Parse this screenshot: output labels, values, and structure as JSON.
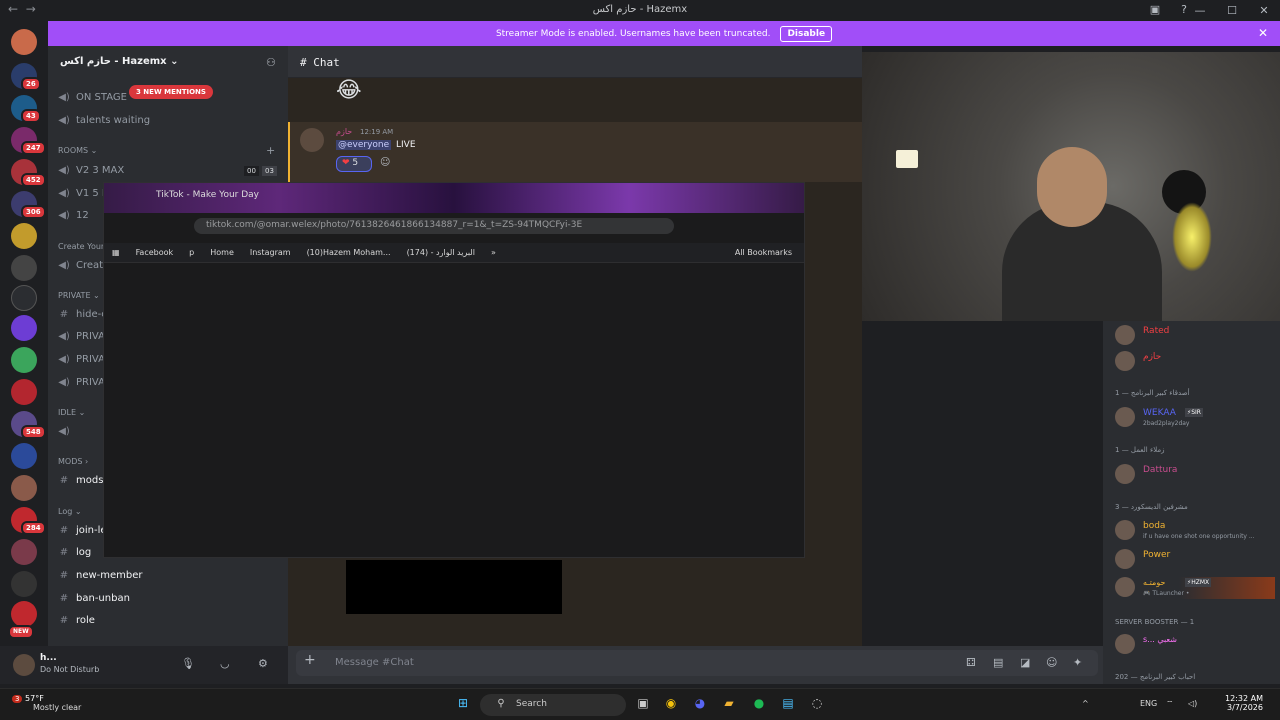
{
  "window": {
    "title": "حازم اكس - Hazemx",
    "nav_back": "←",
    "nav_forward": "→",
    "controls": [
      "—",
      "☐",
      "✕"
    ]
  },
  "banner": {
    "text": "Streamer Mode is enabled. Usernames have been truncated.",
    "disable_label": "Disable",
    "close": "✕"
  },
  "server": {
    "name": "حازم اكس - Hazemx ⌄",
    "mentions_badge": "3 NEW MENTIONS",
    "channels": [
      {
        "name": "ON STAGE"
      },
      {
        "name": "talents waiting"
      }
    ],
    "rooms_label": "ROOMS ⌄",
    "rooms": [
      {
        "name": "V2 3 MAX",
        "count_a": "00",
        "count_b": "03"
      },
      {
        "name": "V1 5 M"
      },
      {
        "name": "12"
      }
    ],
    "create_label": "Create Your",
    "create_item": "Create",
    "private_label": "PRIVATE ⌄",
    "private_items": [
      "hide-c",
      "PRIVA",
      "PRIVA",
      "PRIVA"
    ],
    "idle_label": "IDLE ⌄",
    "mods_label": "MODS ›",
    "mods_items": [
      "mods"
    ],
    "log_label": "Log ⌄",
    "log_items": [
      "join-le",
      "log",
      "new-member",
      "ban-unban",
      "role"
    ]
  },
  "guild_badges": [
    "26",
    "43",
    "247",
    "452",
    "306",
    "548",
    "284",
    "NEW"
  ],
  "user_panel": {
    "name": "h...",
    "status": "Do Not Disturb"
  },
  "chat": {
    "channel_name": "Chat",
    "emoji": "😂",
    "message": {
      "author": "حازم",
      "time": "12:19 AM",
      "mention": "@everyone",
      "text": "LIVE",
      "reaction_emoji": "❤",
      "reaction_count": "5"
    },
    "composer_placeholder": "Message #Chat"
  },
  "browser": {
    "tab_title": "TikTok - Make Your Day",
    "url": "tiktok.com/@omar.welex/photo/7613826461866134887_r=1&_t=ZS-94TMQCFyi-3E",
    "bookmarks": [
      "Facebook",
      "p",
      "Home",
      "Instagram",
      "(10)Hazem Moham...",
      "(174) - البريد الوارد",
      "»"
    ],
    "all_bookmarks": "All Bookmarks"
  },
  "members": {
    "top": [
      {
        "name": "Rated",
        "color": "#f23f43"
      },
      {
        "name": "حازم",
        "color": "#f23f43"
      }
    ],
    "groups": [
      {
        "label": "أصدقاء كبير البرنامج — 1",
        "members": [
          {
            "name": "WEKAA",
            "tag": "⚡SIR",
            "sub": "2bad2play2day",
            "color": "#5865f2"
          }
        ]
      },
      {
        "label": "زملاء العمل — 1",
        "members": [
          {
            "name": "Dattura",
            "color": "#c84d8e"
          }
        ]
      },
      {
        "label": "مشرفين الديسكورد — 3",
        "members": [
          {
            "name": "boda",
            "sub": "if u have one shot one opportunity ...",
            "color": "#f0b232"
          },
          {
            "name": "Power",
            "color": "#f0b232"
          },
          {
            "name": "حومتـه",
            "tag": "⚡HZMX",
            "sub": "🎮 TLauncher •",
            "color": "#f0b232"
          }
        ]
      },
      {
        "label": "SERVER BOOSTER — 1",
        "members": [
          {
            "name": "s... ‎شعبي",
            "color": "#ff73fa"
          }
        ]
      },
      {
        "label": "احباب كبير البرنامج — 202",
        "members": []
      }
    ]
  },
  "taskbar": {
    "weather_temp": "57°F",
    "weather_desc": "Mostly clear",
    "weather_badge": "3",
    "search_label": "Search",
    "lang": "ENG",
    "time": "12:32 AM",
    "date": "3/7/2026"
  },
  "colors": {
    "banner": "#a14ef8",
    "mention_badge": "#da373c",
    "discord_bg": "#313338"
  }
}
